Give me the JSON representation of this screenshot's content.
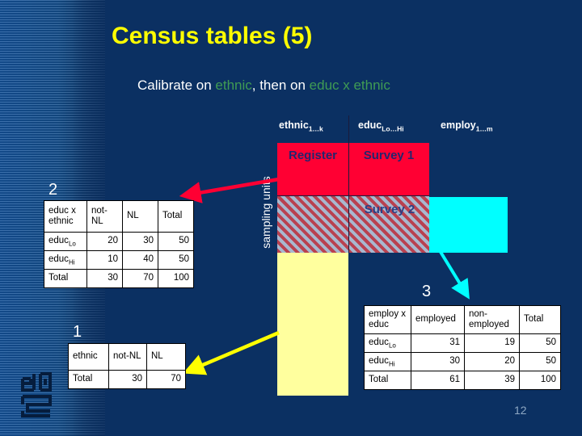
{
  "slide": {
    "title": "Census tables (5)",
    "subtitle_parts": [
      {
        "text": "Calibrate on ",
        "color": "#ffffff"
      },
      {
        "text": "ethnic",
        "color": "#3f9b54"
      },
      {
        "text": ", then on ",
        "color": "#ffffff"
      },
      {
        "text": "educ x ethnic",
        "color": "#3f9b54"
      }
    ],
    "subtitle_plain": "Calibrate on ethnic, then on educ x ethnic",
    "page_number": "12",
    "background_color": "#0b3062",
    "title_color": "#ffff00",
    "logo_name": "cbs-logo"
  },
  "column_labels": {
    "ethnic": {
      "base": "ethnic",
      "sub": "1…k"
    },
    "educ": {
      "base": "educ",
      "sub": "Lo…Hi"
    },
    "employ": {
      "base": "employ",
      "sub": "1…m"
    }
  },
  "axis": {
    "sampling_units": "sampling units"
  },
  "blocks": [
    {
      "name": "register-block",
      "label": "Register",
      "color": "#ff0033",
      "label_color": "#25256d"
    },
    {
      "name": "survey1-block",
      "label": "Survey 1",
      "color": "#ff0033",
      "label_color": "#25256d"
    },
    {
      "name": "survey2-block",
      "label": "Survey 2",
      "color": "#b94150",
      "label_color": "#2a3f86",
      "pattern": "diagonal-hatch"
    },
    {
      "name": "cyan-block",
      "label": "",
      "color": "#00ffff"
    },
    {
      "name": "yellow-block",
      "label": "",
      "color": "#ffff9e"
    }
  ],
  "steps": {
    "one": "1",
    "two": "2",
    "three": "3"
  },
  "arrows": [
    {
      "name": "red-arrow",
      "color": "#ff0033",
      "from_label": "register-block",
      "to_label": "table-2"
    },
    {
      "name": "cyan-arrow",
      "color": "#00ffff",
      "from_label": "cyan-block",
      "to_label": "table-3"
    },
    {
      "name": "yellow-arrow",
      "color": "#ffff00",
      "from_label": "yellow-block",
      "to_label": "table-1"
    }
  ],
  "tables": {
    "table2": {
      "name": "table-2",
      "headers": [
        "educ x ethnic",
        "not-NL",
        "NL",
        "Total"
      ],
      "rows": [
        {
          "label": "educ",
          "label_sub": "Lo",
          "values": [
            "20",
            "30",
            "50"
          ]
        },
        {
          "label": "educ",
          "label_sub": "Hi",
          "values": [
            "10",
            "40",
            "50"
          ]
        },
        {
          "label": "Total",
          "label_sub": "",
          "values": [
            "30",
            "70",
            "100"
          ]
        }
      ]
    },
    "table1": {
      "name": "table-1",
      "headers": [
        "ethnic",
        "not-NL",
        "NL"
      ],
      "rows": [
        {
          "label": "Total",
          "label_sub": "",
          "values": [
            "30",
            "70"
          ]
        }
      ]
    },
    "table3": {
      "name": "table-3",
      "headers": [
        "employ x educ",
        "employed",
        "non-employed",
        "Total"
      ],
      "rows": [
        {
          "label": "educ",
          "label_sub": "Lo",
          "values": [
            "31",
            "19",
            "50"
          ]
        },
        {
          "label": "educ",
          "label_sub": "Hi",
          "values": [
            "30",
            "20",
            "50"
          ]
        },
        {
          "label": "Total",
          "label_sub": "",
          "values": [
            "61",
            "39",
            "100"
          ]
        }
      ]
    }
  }
}
